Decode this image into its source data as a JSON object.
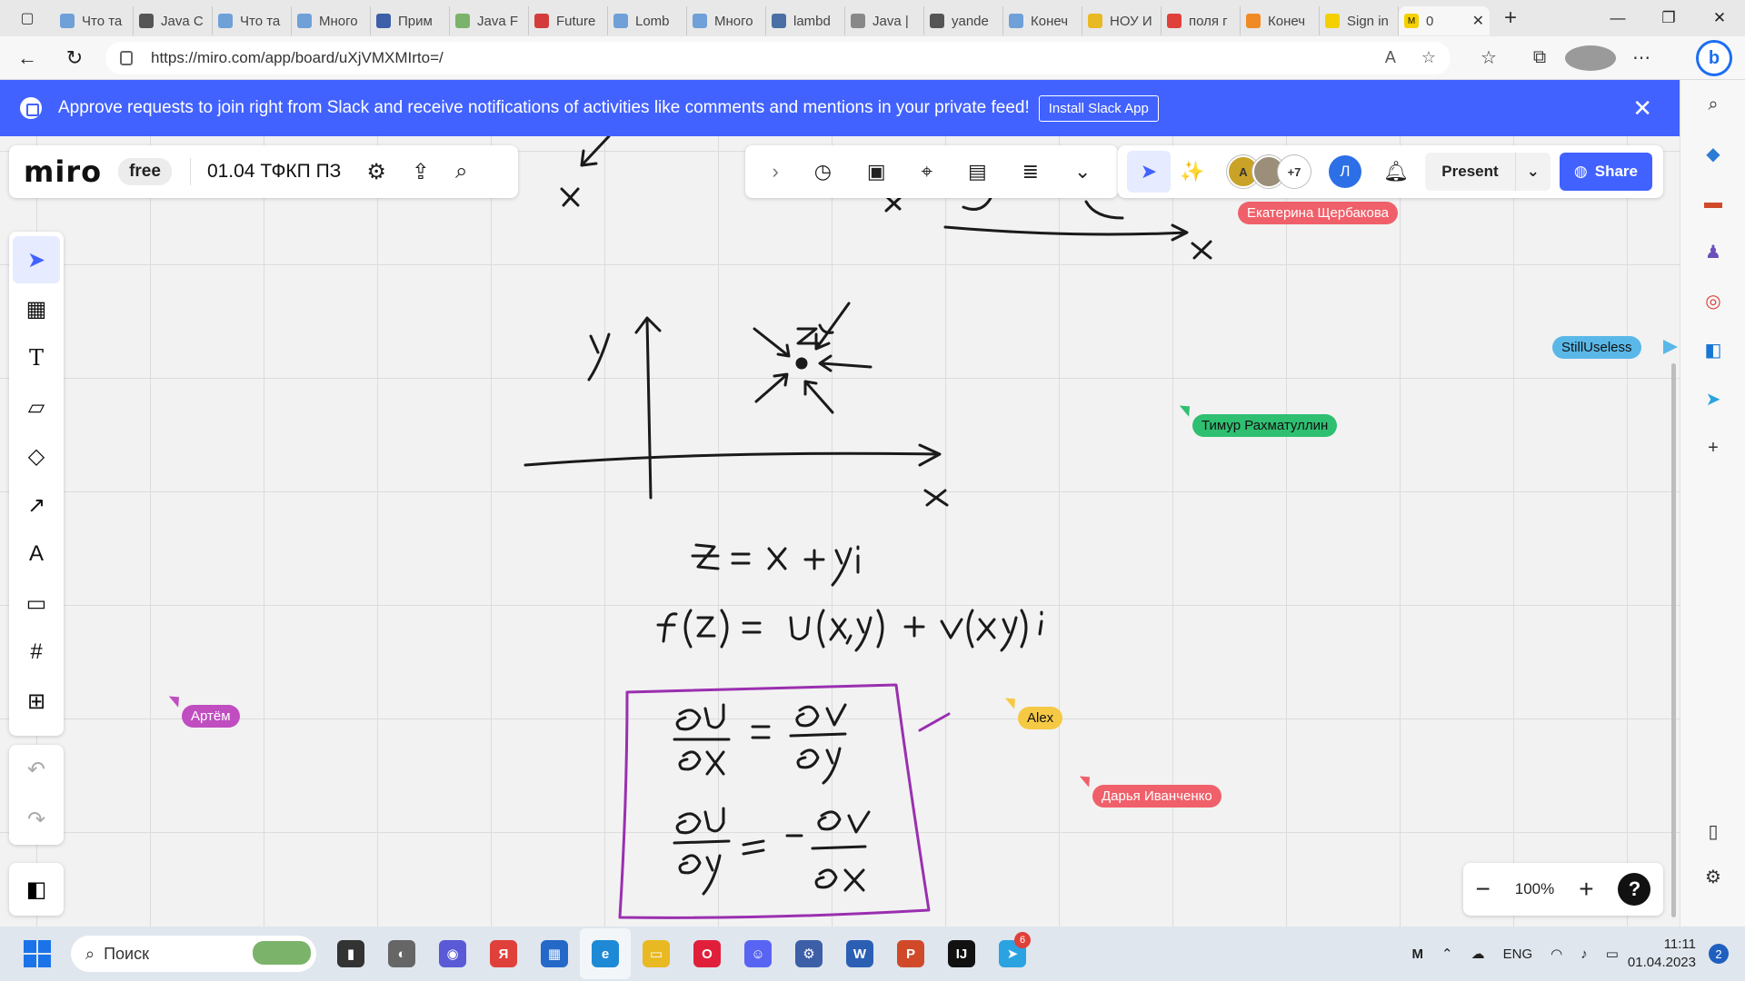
{
  "browser": {
    "tabs": [
      {
        "title": "Что та",
        "color": "#6fa0d8"
      },
      {
        "title": "Java C",
        "color": "#555555"
      },
      {
        "title": "Что та",
        "color": "#6fa0d8"
      },
      {
        "title": "Много",
        "color": "#6fa0d8"
      },
      {
        "title": "Прим",
        "color": "#3d5fa8"
      },
      {
        "title": "Java F",
        "color": "#7bb36a"
      },
      {
        "title": "Future",
        "color": "#d43c3c"
      },
      {
        "title": "Lomb",
        "color": "#6fa0d8"
      },
      {
        "title": "Много",
        "color": "#6fa0d8"
      },
      {
        "title": "lambd",
        "color": "#4a6fa5"
      },
      {
        "title": "Java |",
        "color": "#888888"
      },
      {
        "title": "yande",
        "color": "#555555"
      },
      {
        "title": "Конеч",
        "color": "#6fa0d8"
      },
      {
        "title": "НОУ И",
        "color": "#e8b923"
      },
      {
        "title": "поля г",
        "color": "#e0403a"
      },
      {
        "title": "Конеч",
        "color": "#f08a24"
      },
      {
        "title": "Sign in",
        "color": "#f5d000"
      }
    ],
    "active_tab": {
      "title": "0",
      "close": "✕"
    },
    "new_tab": "+",
    "url": "https://miro.com/app/board/uXjVMXMIrto=/"
  },
  "banner": {
    "text": "Approve requests to join right from Slack and receive notifications of activities like comments and mentions in your private feed!",
    "button": "Install Slack App",
    "close": "✕"
  },
  "miro": {
    "logo": "miro",
    "plan": "free",
    "board_title": "01.04 ТФКП ПЗ",
    "avatars": [
      {
        "initial": "A",
        "color": "#c9a227"
      },
      {
        "initial": "",
        "color": "#9b8f7a"
      }
    ],
    "more_users": "+7",
    "me_initial": "Л",
    "present_label": "Present",
    "share_label": "Share",
    "zoom_level": "100%",
    "help": "?"
  },
  "cursors": [
    {
      "name": "Екатерина Щербакова",
      "color": "#f0606a"
    },
    {
      "name": "StillUseless",
      "color": "#5ab8e8"
    },
    {
      "name": "Тимур Рахматуллин",
      "color": "#2fbf71"
    },
    {
      "name": "Артём",
      "color": "#c04ec0"
    },
    {
      "name": "Alex",
      "color": "#f6c945"
    },
    {
      "name": "Дарья Иванченко",
      "color": "#f0606a"
    }
  ],
  "taskbar": {
    "search_placeholder": "Поиск",
    "apps": [
      {
        "glyph": "▮",
        "color": "#333333"
      },
      {
        "glyph": "◐",
        "color": "#666666"
      },
      {
        "glyph": "◉",
        "color": "#5a5ad6"
      },
      {
        "glyph": "Я",
        "color": "#e0403a"
      },
      {
        "glyph": "▦",
        "color": "#2468c8"
      },
      {
        "glyph": "e",
        "color": "#1e8ad6"
      },
      {
        "glyph": "▭",
        "color": "#e8b923"
      },
      {
        "glyph": "O",
        "color": "#e0203a"
      },
      {
        "glyph": "☺",
        "color": "#5865f2"
      },
      {
        "glyph": "⚙",
        "color": "#3d5fa8"
      },
      {
        "glyph": "W",
        "color": "#2b5fb4"
      },
      {
        "glyph": "P",
        "color": "#d04a2a"
      },
      {
        "glyph": "IJ",
        "color": "#111111"
      },
      {
        "glyph": "➤",
        "color": "#2aa3e0"
      }
    ],
    "telegram_badge": "6",
    "discord_badge": "",
    "lang": "ENG",
    "time": "11:11",
    "date": "01.04.2023",
    "notifications": "2"
  }
}
